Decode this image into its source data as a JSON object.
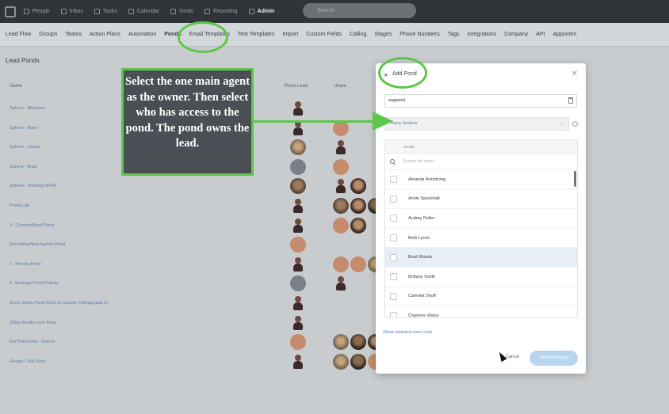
{
  "topnav": {
    "items": [
      {
        "label": "People",
        "icon": "people-icon"
      },
      {
        "label": "Inbox",
        "icon": "inbox-icon"
      },
      {
        "label": "Tasks",
        "icon": "tasks-icon"
      },
      {
        "label": "Calendar",
        "icon": "calendar-icon"
      },
      {
        "label": "Deals",
        "icon": "deals-icon"
      },
      {
        "label": "Reporting",
        "icon": "reporting-icon"
      },
      {
        "label": "Admin",
        "icon": "admin-icon",
        "active": true
      }
    ],
    "search_placeholder": "Search"
  },
  "subtabs": [
    "Lead Flow",
    "Groups",
    "Teams",
    "Action Plans",
    "Automation",
    "Ponds",
    "Email Templates",
    "Text Templates",
    "Import",
    "Custom Fields",
    "Calling",
    "Stages",
    "Phone Numbers",
    "Tags",
    "Integrations",
    "Company",
    "API",
    "Appointm"
  ],
  "page": {
    "title": "Lead Ponds",
    "columns": {
      "name": "Name",
      "pond_lead": "Pond Lead",
      "users": "Users"
    },
    "rows": [
      {
        "name": "Sphere - Morderm",
        "lead": "person",
        "users": []
      },
      {
        "name": "Sphere - Barry",
        "lead": "person",
        "users": [
          "init-tan"
        ]
      },
      {
        "name": "Sphere - Jimmy",
        "lead": "photo-c",
        "users": [
          "person"
        ]
      },
      {
        "name": "Sphere - Brad",
        "lead": "init-grey",
        "users": [
          "init-tan"
        ]
      },
      {
        "name": "Sphere - Working HPVA",
        "lead": "photo-b",
        "users": [
          "person",
          "photo-a"
        ]
      },
      {
        "name": "Portal Lab",
        "lead": "person",
        "users": [
          "photo-b",
          "photo-a",
          "photo-d"
        ]
      },
      {
        "name": "X - Contact/Seed Pond",
        "lead": "person",
        "users": [
          "init-tan",
          "photo-a"
        ]
      },
      {
        "name": "Recruiting New Agents Pond",
        "lead": "init-tan",
        "users": []
      },
      {
        "name": "1 - Priority Pond",
        "lead": "person",
        "users": [
          "init-tan",
          "init-tan",
          "photo-c"
        ]
      },
      {
        "name": "2- Strategic Pond Priority",
        "lead": "init-grey",
        "users": [
          "person"
        ]
      },
      {
        "name": "Zoom Zillow Pond (Click to answer Callings past 3)",
        "lead": "person",
        "users": []
      },
      {
        "name": "Zillow Realtor.com Pond",
        "lead": "person",
        "users": []
      },
      {
        "name": "KW Pond New - Interns",
        "lead": "init-tan",
        "users": [
          "photo-c",
          "photo-d",
          "photo-a",
          "photo-b",
          "photo-c",
          "photo-a",
          "photo-b"
        ]
      },
      {
        "name": "Google / ISA Pond",
        "lead": "person",
        "users": [
          "photo-c",
          "photo-d",
          "init-tan",
          "photo-a",
          "photo-b",
          "photo-c",
          "photo-a",
          "photo-b",
          "photo-d",
          "photo-c",
          "photo-a",
          "photo-b"
        ]
      }
    ]
  },
  "modal": {
    "title": "Add Pond",
    "name_value": "wagwon|",
    "owner_value": "Barry Jenkins",
    "list_header": "NAME",
    "search_placeholder": "Search for users",
    "users": [
      {
        "name": "Amanda Armstrong",
        "highlighted": false
      },
      {
        "name": "Annie Speckhalt",
        "highlighted": false
      },
      {
        "name": "Audrey Roller",
        "highlighted": false
      },
      {
        "name": "Beth Lynch",
        "highlighted": false
      },
      {
        "name": "Brad Woods",
        "highlighted": true
      },
      {
        "name": "Brittany Smith",
        "highlighted": false
      },
      {
        "name": "Camelot Shuff",
        "highlighted": false
      },
      {
        "name": "Charlene Waiss",
        "highlighted": false
      }
    ],
    "show_selected_label": "Show selected users only",
    "cancel_label": "Cancel",
    "save_label": "Save Changes"
  },
  "annotation": {
    "text": "Select the one main agent as the owner. Then select who has access to the pond. The pond owns the lead.",
    "color": "#5cc74a"
  }
}
